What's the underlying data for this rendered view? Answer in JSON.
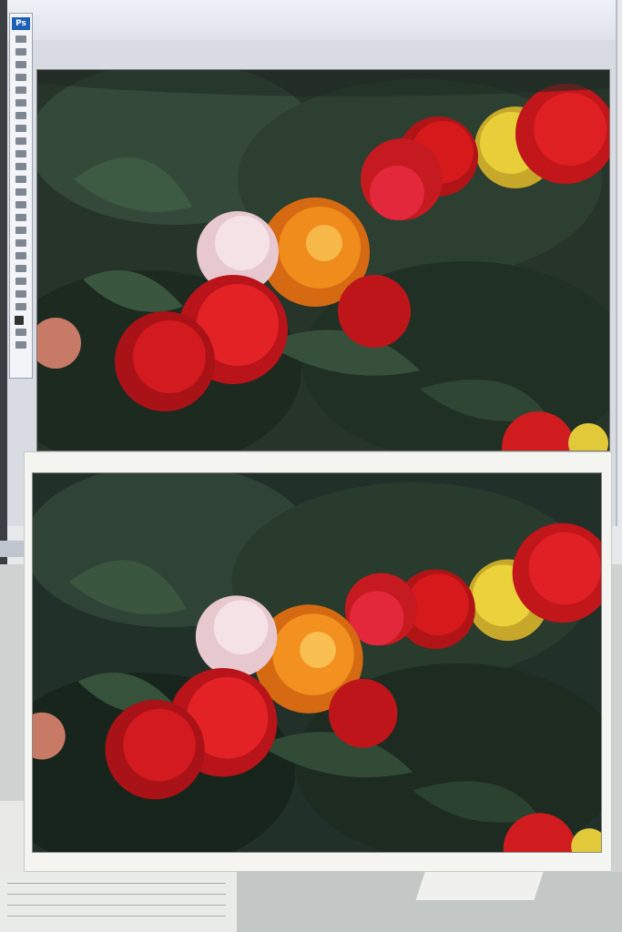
{
  "toolbox": {
    "logo_text": "Ps",
    "tool_icons": [
      "move-icon",
      "marquee-icon",
      "lasso-icon",
      "magic-wand-icon",
      "crop-icon",
      "eyedropper-icon",
      "healing-icon",
      "brush-icon",
      "stamp-icon",
      "history-brush-icon",
      "eraser-icon",
      "gradient-icon",
      "blur-icon",
      "dodge-icon",
      "pen-icon",
      "type-icon",
      "path-select-icon",
      "shape-icon",
      "notes-icon",
      "eyedropper2-icon",
      "hand-icon",
      "zoom-icon",
      "color-swatch-icon",
      "mask-icon",
      "screen-mode-icon"
    ]
  },
  "photo_description": {
    "subject": "begonia flowers",
    "colors": {
      "red": "#d61a1c",
      "orange": "#f08c1c",
      "yellow": "#e8cf3a",
      "pink_white": "#f2d6dc",
      "leaf_dark": "#1f3325",
      "leaf_mid": "#2f4a34",
      "bg": "#2a352b"
    }
  }
}
